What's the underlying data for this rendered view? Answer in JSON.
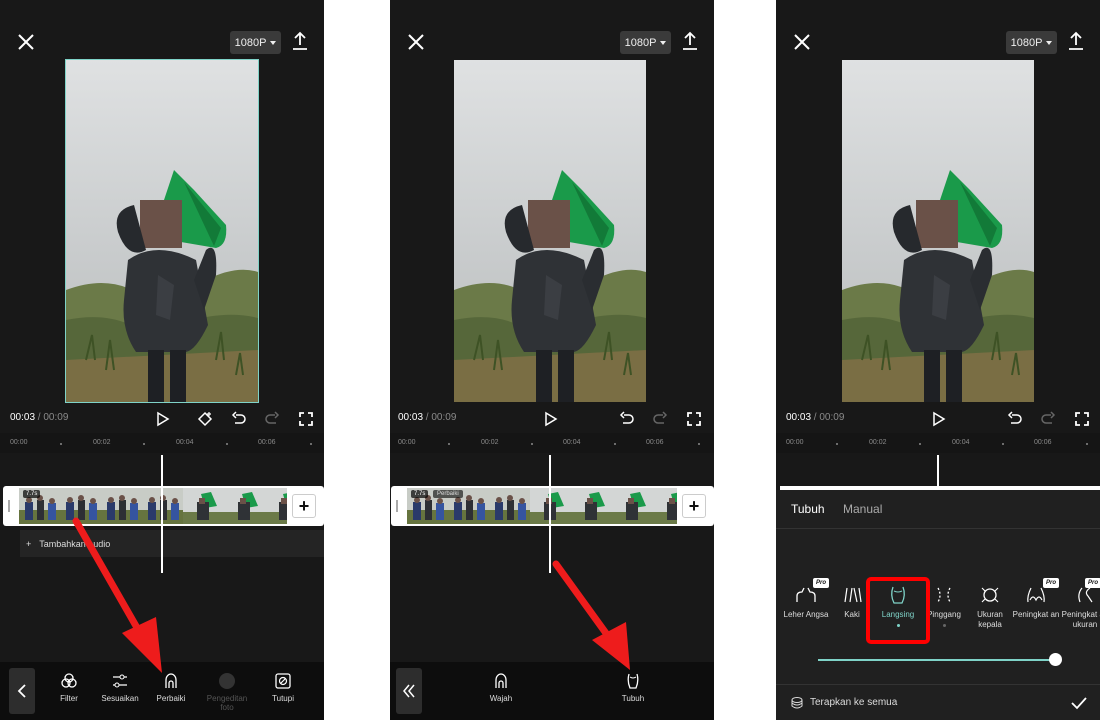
{
  "colors": {
    "accent": "#7fd3c8",
    "highlight": "#ff0000",
    "background": "#181818"
  },
  "panels": [
    {
      "resolution": "1080P",
      "time_current": "00:03",
      "time_total": " / 00:09",
      "ruler": [
        "00:00",
        "00:02",
        "00:04",
        "00:06"
      ],
      "clip_duration": "7.7s",
      "audio_label": "Tambahkan audio",
      "toolbar": [
        {
          "label": "Filter",
          "icon": "filter-icon"
        },
        {
          "label": "Sesuaikan",
          "icon": "adjust-icon"
        },
        {
          "label": "Perbaiki",
          "icon": "retouch-icon"
        },
        {
          "label": "Pengeditan foto",
          "icon": "photo-edit-icon",
          "disabled": true
        },
        {
          "label": "Tutupi",
          "icon": "overlay-icon"
        }
      ]
    },
    {
      "resolution": "1080P",
      "time_current": "00:03",
      "time_total": " / 00:09",
      "ruler": [
        "00:00",
        "00:02",
        "00:04",
        "00:06"
      ],
      "clip_duration": "7.7s",
      "clip_tag": "Perbaiki",
      "toolbar": [
        {
          "label": "Wajah",
          "icon": "face-icon"
        },
        {
          "label": "Tubuh",
          "icon": "body-icon"
        }
      ]
    },
    {
      "resolution": "1080P",
      "time_current": "00:03",
      "time_total": " / 00:09",
      "ruler": [
        "00:00",
        "00:02",
        "00:04",
        "00:06"
      ],
      "tabs": [
        "Tubuh",
        "Manual"
      ],
      "options": [
        {
          "label": "Leher Angsa",
          "pro": true
        },
        {
          "label": "Kaki",
          "pro": false
        },
        {
          "label": "Langsing",
          "pro": false,
          "selected": true
        },
        {
          "label": "Pinggang",
          "pro": false
        },
        {
          "label": "Ukuran kepala",
          "pro": false
        },
        {
          "label": "Peningkat an",
          "pro": true
        },
        {
          "label": "Peningkat an ukuran",
          "pro": true
        }
      ],
      "pro_badge": "Pro",
      "slider_level": 1.0,
      "apply_all": "Terapkan ke semua"
    }
  ]
}
